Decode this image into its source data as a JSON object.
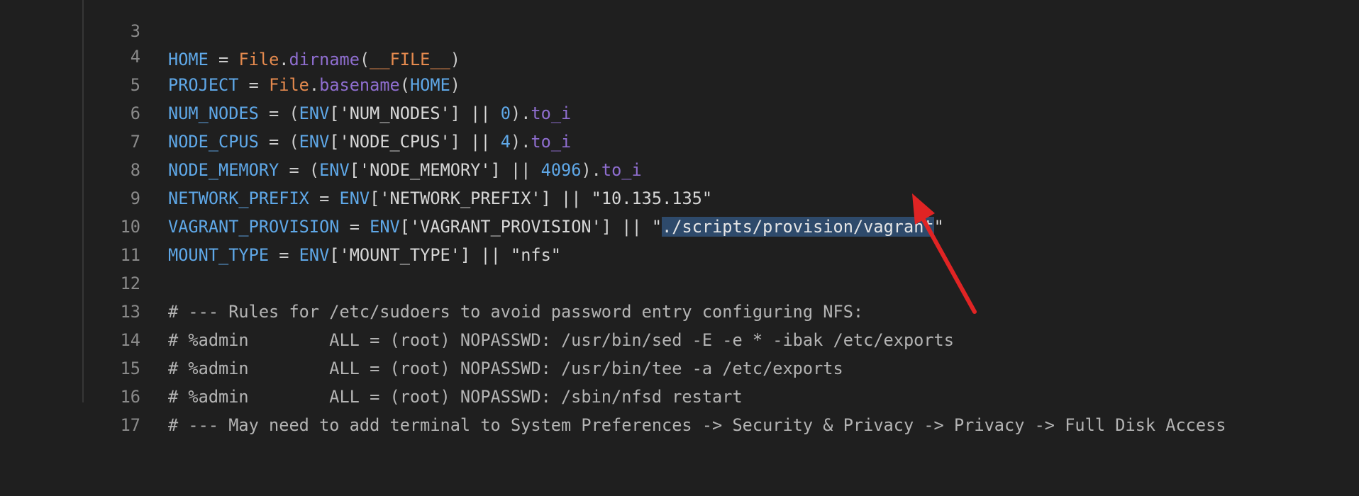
{
  "editor": {
    "lines": [
      {
        "number": "3",
        "parts": [
          "HOME",
          " = ",
          "File",
          ".",
          "dirname",
          "(",
          "__FILE__",
          ")"
        ]
      },
      {
        "number": "4",
        "parts": [
          "PROJECT",
          " = ",
          "File",
          ".",
          "basename",
          "(",
          "HOME",
          ")"
        ]
      },
      {
        "number": "5",
        "parts": [
          "NUM_NODES",
          " = (",
          "ENV",
          "['NUM_NODES'] || ",
          "0",
          ").",
          "to_i"
        ]
      },
      {
        "number": "6",
        "parts": [
          "NODE_CPUS",
          " = (",
          "ENV",
          "['NODE_CPUS'] || ",
          "4",
          ").",
          "to_i"
        ]
      },
      {
        "number": "7",
        "parts": [
          "NODE_MEMORY",
          " = (",
          "ENV",
          "['NODE_MEMORY'] || ",
          "4096",
          ").",
          "to_i"
        ]
      },
      {
        "number": "8",
        "parts": [
          "NETWORK_PREFIX",
          " = ",
          "ENV",
          "['NETWORK_PREFIX'] || ",
          "\"10.135.135\""
        ]
      },
      {
        "number": "9",
        "parts": [
          "VAGRANT_PROVISION",
          " = ",
          "ENV",
          "['VAGRANT_PROVISION'] || ",
          "\"",
          "./scripts/provision/vagrant",
          "\""
        ]
      },
      {
        "number": "10",
        "parts": [
          "MOUNT_TYPE",
          " = ",
          "ENV",
          "['MOUNT_TYPE'] || ",
          "\"nfs\""
        ]
      },
      {
        "number": "11",
        "parts": []
      },
      {
        "number": "12",
        "parts": [
          "# --- Rules for /etc/sudoers to avoid password entry configuring NFS:"
        ]
      },
      {
        "number": "13",
        "parts": [
          "# %admin        ALL = (root) NOPASSWD: /usr/bin/sed -E -e * -ibak /etc/exports"
        ]
      },
      {
        "number": "14",
        "parts": [
          "# %admin        ALL = (root) NOPASSWD: /usr/bin/tee -a /etc/exports"
        ]
      },
      {
        "number": "15",
        "parts": [
          "# %admin        ALL = (root) NOPASSWD: /sbin/nfsd restart"
        ]
      },
      {
        "number": "16",
        "parts": [
          "# --- May need to add terminal to System Preferences -> Security & Privacy -> Privacy -> Full Disk Access"
        ]
      },
      {
        "number": "17",
        "parts": []
      }
    ]
  },
  "colors": {
    "background": "#1f1f1f",
    "selection": "#2e4a6b",
    "arrow": "#e02424"
  }
}
